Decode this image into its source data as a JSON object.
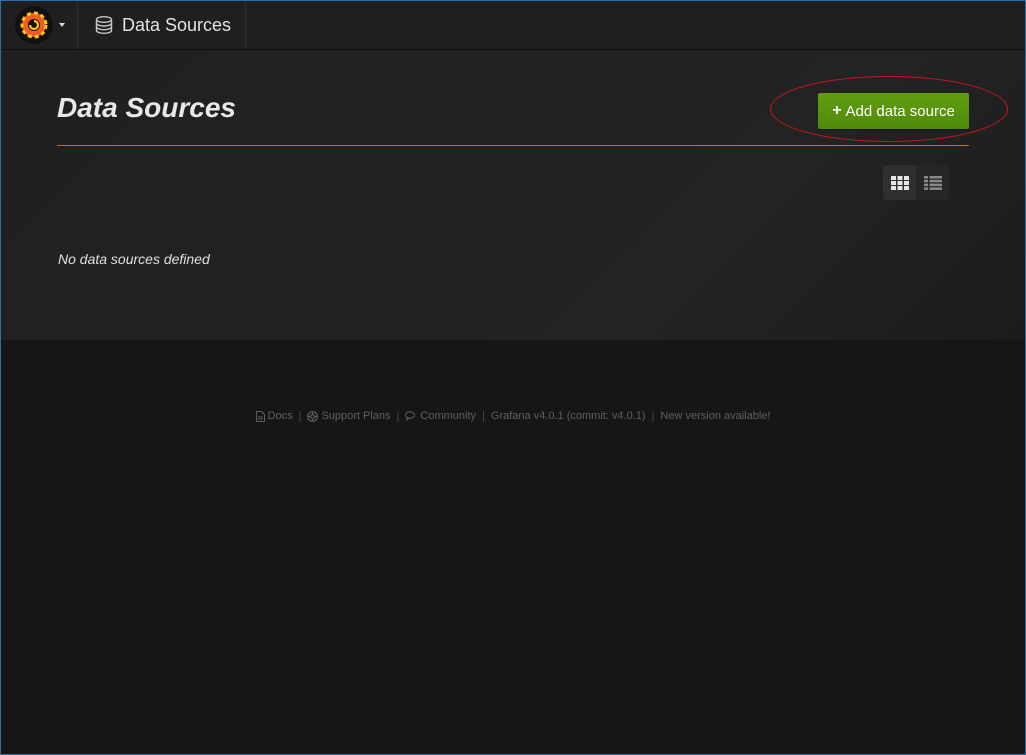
{
  "navbar": {
    "section_title": "Data Sources"
  },
  "page": {
    "title": "Data Sources",
    "add_button_label": "Add data source",
    "empty_message": "No data sources defined"
  },
  "footer": {
    "docs": "Docs",
    "support": "Support Plans",
    "community": "Community",
    "version": "Grafana v4.0.1 (commit: v4.0.1)",
    "new_version": "New version available!"
  },
  "colors": {
    "accent_orange": "#eb7b18",
    "button_green": "#5a940e",
    "header_line": "#b8742c",
    "annotation_red": "#c8161e"
  }
}
